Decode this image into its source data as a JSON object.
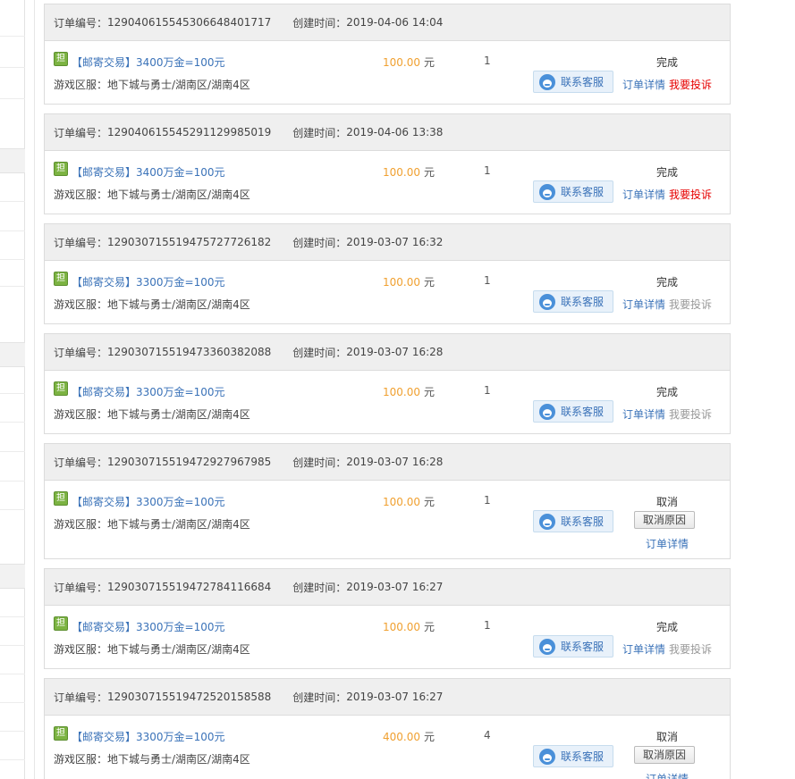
{
  "orders": [
    {
      "order_label": "订单编号：",
      "order_no": "12904061554530664840171​7",
      "created_label": "创建时间：",
      "created": "2019-04-06 14:04",
      "badge": "担",
      "title": "【邮寄交易】3400万金=100元",
      "region_label": "游戏区服：",
      "region": "地下城与勇士/湖南区/湖南4区",
      "price": "100.00",
      "unit": "元",
      "qty": "1",
      "service": "联系客服",
      "status": "完成",
      "detail": "订单详情",
      "complain": "我要投诉",
      "complain_active": true
    },
    {
      "order_label": "订单编号：",
      "order_no": "12904061554529112998501​9",
      "created_label": "创建时间：",
      "created": "2019-04-06 13:38",
      "badge": "担",
      "title": "【邮寄交易】3400万金=100元",
      "region_label": "游戏区服：",
      "region": "地下城与勇士/湖南区/湖南4区",
      "price": "100.00",
      "unit": "元",
      "qty": "1",
      "service": "联系客服",
      "status": "完成",
      "detail": "订单详情",
      "complain": "我要投诉",
      "complain_active": true
    },
    {
      "order_label": "订单编号：",
      "order_no": "129030715519475727726182",
      "created_label": "创建时间：",
      "created": "2019-03-07 16:32",
      "badge": "担",
      "title": "【邮寄交易】3300万金=100元",
      "region_label": "游戏区服：",
      "region": "地下城与勇士/湖南区/湖南4区",
      "price": "100.00",
      "unit": "元",
      "qty": "1",
      "service": "联系客服",
      "status": "完成",
      "detail": "订单详情",
      "complain": "我要投诉",
      "complain_active": false
    },
    {
      "order_label": "订单编号：",
      "order_no": "129030715519473360382088",
      "created_label": "创建时间：",
      "created": "2019-03-07 16:28",
      "badge": "担",
      "title": "【邮寄交易】3300万金=100元",
      "region_label": "游戏区服：",
      "region": "地下城与勇士/湖南区/湖南4区",
      "price": "100.00",
      "unit": "元",
      "qty": "1",
      "service": "联系客服",
      "status": "完成",
      "detail": "订单详情",
      "complain": "我要投诉",
      "complain_active": false
    },
    {
      "order_label": "订单编号：",
      "order_no": "129030715519472927967985",
      "created_label": "创建时间：",
      "created": "2019-03-07 16:28",
      "badge": "担",
      "title": "【邮寄交易】3300万金=100元",
      "region_label": "游戏区服：",
      "region": "地下城与勇士/湖南区/湖南4区",
      "price": "100.00",
      "unit": "元",
      "qty": "1",
      "service": "联系客服",
      "status": "取消",
      "cancel_reason": "取消原因",
      "detail": "订单详情"
    },
    {
      "order_label": "订单编号：",
      "order_no": "129030715519472784116684",
      "created_label": "创建时间：",
      "created": "2019-03-07 16:27",
      "badge": "担",
      "title": "【邮寄交易】3300万金=100元",
      "region_label": "游戏区服：",
      "region": "地下城与勇士/湖南区/湖南4区",
      "price": "100.00",
      "unit": "元",
      "qty": "1",
      "service": "联系客服",
      "status": "完成",
      "detail": "订单详情",
      "complain": "我要投诉",
      "complain_active": false
    },
    {
      "order_label": "订单编号：",
      "order_no": "129030715519472520158588",
      "created_label": "创建时间：",
      "created": "2019-03-07 16:27",
      "badge": "担",
      "title": "【邮寄交易】3300万金=100元",
      "region_label": "游戏区服：",
      "region": "地下城与勇士/湖南区/湖南4区",
      "price": "400.00",
      "unit": "元",
      "qty": "4",
      "service": "联系客服",
      "status": "取消",
      "cancel_reason": "取消原因",
      "detail": "订单详情"
    }
  ]
}
